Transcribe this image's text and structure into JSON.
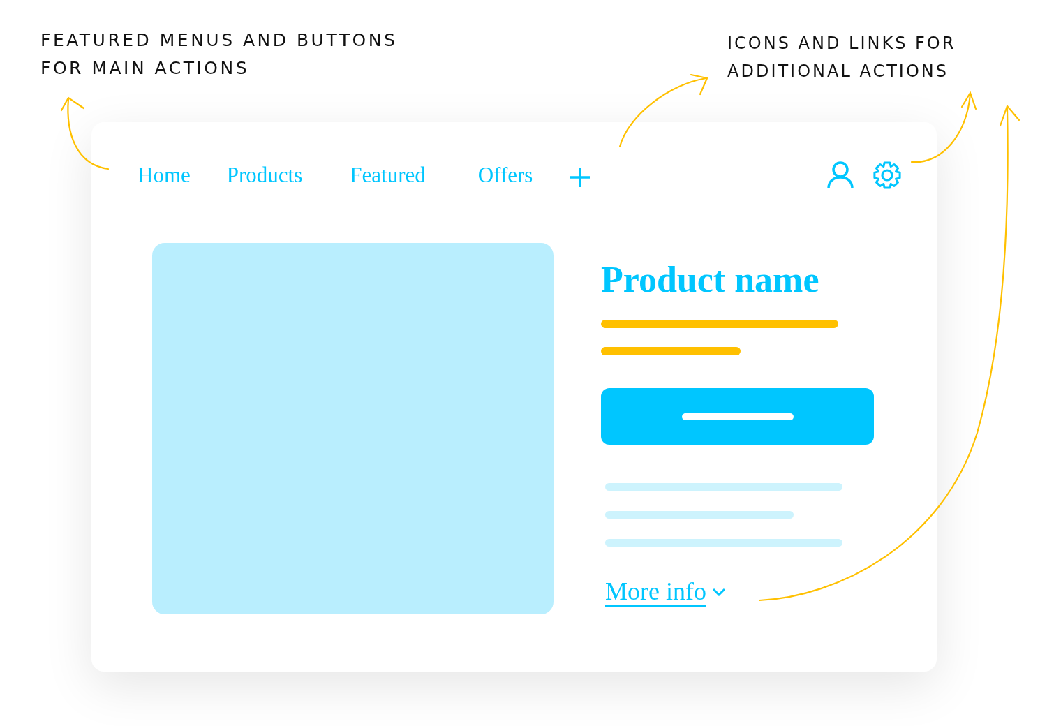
{
  "annotations": [
    {
      "lines": [
        "FEATURED MENUS AND BUTTONS",
        "FOR MAIN ACTIONS"
      ]
    },
    {
      "lines": [
        "ICONS AND LINKS FOR",
        "ADDITIONAL ACTIONS"
      ]
    }
  ],
  "nav": {
    "items": [
      {
        "label": "Home"
      },
      {
        "label": "Products"
      },
      {
        "label": "Featured"
      },
      {
        "label": "Offers"
      }
    ]
  },
  "product": {
    "title": "Product name",
    "link": "More info"
  }
}
